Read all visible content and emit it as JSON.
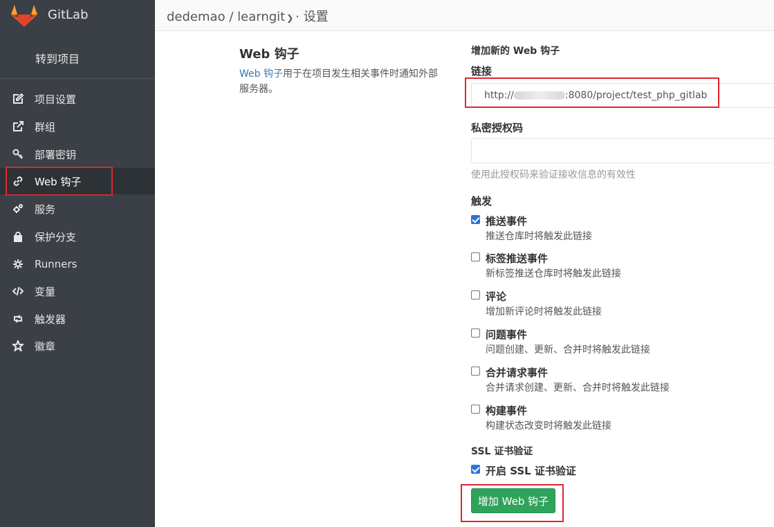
{
  "sidebar": {
    "brand": "GitLab",
    "goto_project": "转到项目",
    "items": [
      {
        "label": "项目设置",
        "icon": "edit-icon"
      },
      {
        "label": "群组",
        "icon": "share-icon"
      },
      {
        "label": "部署密钥",
        "icon": "key-icon"
      },
      {
        "label": "Web 钩子",
        "icon": "link-icon"
      },
      {
        "label": "服务",
        "icon": "cogs-icon"
      },
      {
        "label": "保护分支",
        "icon": "lock-icon"
      },
      {
        "label": "Runners",
        "icon": "gear-icon"
      },
      {
        "label": "变量",
        "icon": "code-icon"
      },
      {
        "label": "触发器",
        "icon": "retweet-icon"
      },
      {
        "label": "徽章",
        "icon": "star-icon"
      }
    ]
  },
  "header": {
    "namespace": "dedemao",
    "separator": "/",
    "project": "learngit",
    "page": "· 设置"
  },
  "section": {
    "title": "Web 钩子",
    "desc_link": "Web 钩子",
    "desc_rest": "用于在项目发生相关事件时通知外部服务器。"
  },
  "form": {
    "heading": "增加新的 Web 钩子",
    "url_label": "链接",
    "url_prefix": "http://",
    "url_suffix": ":8080/project/test_php_gitlab",
    "token_label": "私密授权码",
    "token_value": "",
    "token_help": "使用此授权码来验证接收信息的有效性",
    "trigger_label": "触发",
    "triggers": [
      {
        "title": "推送事件",
        "desc": "推送仓库时将触发此链接",
        "checked": true
      },
      {
        "title": "标签推送事件",
        "desc": "新标签推送仓库时将触发此链接",
        "checked": false
      },
      {
        "title": "评论",
        "desc": "增加新评论时将触发此链接",
        "checked": false
      },
      {
        "title": "问题事件",
        "desc": "问题创建、更新、合并时将触发此链接",
        "checked": false
      },
      {
        "title": "合并请求事件",
        "desc": "合并请求创建、更新、合并时将触发此链接",
        "checked": false
      },
      {
        "title": "构建事件",
        "desc": "构建状态改变时将触发此链接",
        "checked": false
      }
    ],
    "ssl_label": "SSL 证书验证",
    "ssl_checkbox": "开启 SSL 证书验证",
    "ssl_checked": true,
    "submit": "增加 Web 钩子"
  },
  "colors": {
    "sidebar_bg": "#3a4045",
    "link": "#3777b0",
    "submit_bg": "#2fa35a",
    "checkbox": "#2d73d8",
    "annotation": "#e0252e"
  }
}
